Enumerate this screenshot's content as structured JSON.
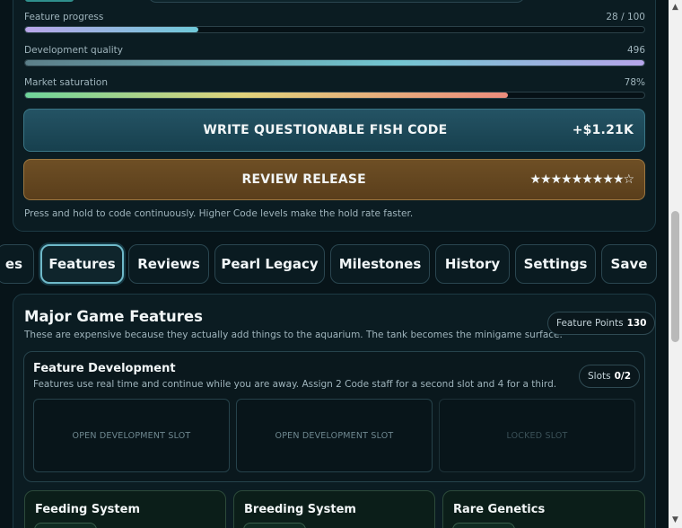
{
  "stats": {
    "progress": {
      "label": "Feature progress",
      "value_text": "28 / 100",
      "fraction": 0.28
    },
    "quality": {
      "label": "Development quality",
      "value_text": "496",
      "fraction": 1.0
    },
    "market": {
      "label": "Market saturation",
      "value_text": "78%",
      "fraction": 0.78
    }
  },
  "actions": {
    "code": {
      "label": "WRITE QUESTIONABLE FISH CODE",
      "reward": "+$1.21K"
    },
    "review": {
      "label": "REVIEW RELEASE",
      "stars": "★★★★★★★★★☆"
    }
  },
  "hint": "Press and hold to code continuously. Higher Code levels make the hold rate faster.",
  "tabs": [
    {
      "label": "es"
    },
    {
      "label": "Features"
    },
    {
      "label": "Reviews"
    },
    {
      "label": "Pearl Legacy"
    },
    {
      "label": "Milestones"
    },
    {
      "label": "History"
    },
    {
      "label": "Settings"
    },
    {
      "label": "Save"
    }
  ],
  "features": {
    "title": "Major Game Features",
    "subtitle": "These are expensive because they actually add things to the aquarium. The tank becomes the minigame surface.",
    "points_label": "Feature Points",
    "points_value": "130",
    "development": {
      "title": "Feature Development",
      "subtitle": "Features use real time and continue while you are away. Assign 2 Code staff for a second slot and 4 for a third.",
      "slots_label": "Slots",
      "slots_value": "0/2",
      "slots": [
        "OPEN DEVELOPMENT SLOT",
        "OPEN DEVELOPMENT SLOT",
        "LOCKED SLOT"
      ]
    },
    "cards": [
      "Feeding System",
      "Breeding System",
      "Rare Genetics"
    ]
  },
  "colors": {
    "accent": "#6fb9c9",
    "code_button": "#245364",
    "review_button": "#6e4f25"
  }
}
